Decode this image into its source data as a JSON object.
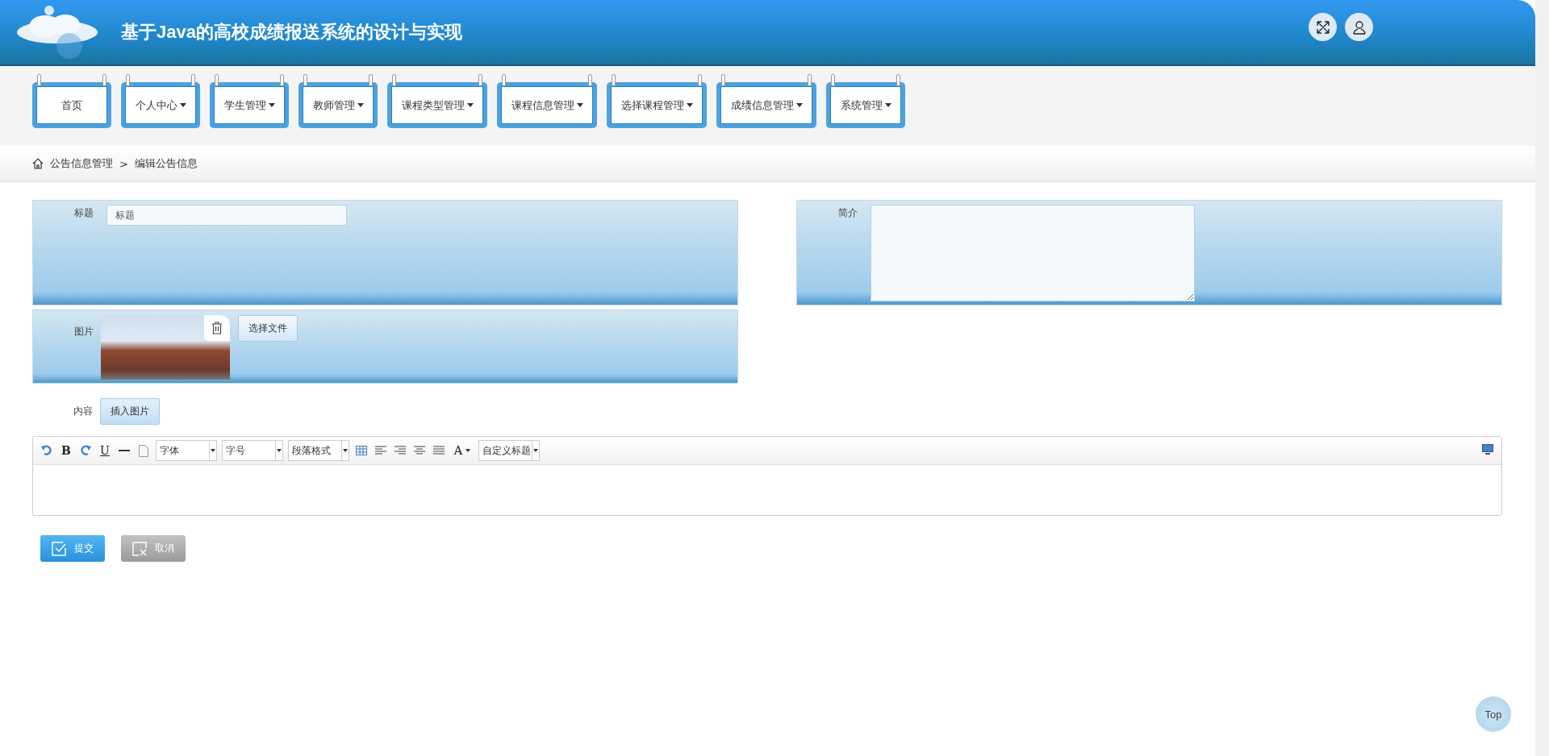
{
  "header": {
    "title": "基于Java的高校成绩报送系统的设计与实现"
  },
  "nav": [
    {
      "label": "首页",
      "dropdown": false
    },
    {
      "label": "个人中心",
      "dropdown": true
    },
    {
      "label": "学生管理",
      "dropdown": true
    },
    {
      "label": "教师管理",
      "dropdown": true
    },
    {
      "label": "课程类型管理",
      "dropdown": true
    },
    {
      "label": "课程信息管理",
      "dropdown": true
    },
    {
      "label": "选择课程管理",
      "dropdown": true
    },
    {
      "label": "成绩信息管理",
      "dropdown": true
    },
    {
      "label": "系统管理",
      "dropdown": true
    }
  ],
  "breadcrumb": {
    "parent": "公告信息管理",
    "separator": ">",
    "current": "编辑公告信息"
  },
  "form": {
    "title_label": "标题",
    "title_placeholder": "标题",
    "summary_label": "简介",
    "image_label": "图片",
    "choose_file": "选择文件",
    "content_label": "内容",
    "insert_image": "插入图片"
  },
  "editor": {
    "toolbar": [
      {
        "kind": "undo"
      },
      {
        "kind": "bold",
        "label": "B"
      },
      {
        "kind": "redo"
      },
      {
        "kind": "underline",
        "label": "U"
      },
      {
        "kind": "hr"
      },
      {
        "kind": "page"
      },
      {
        "kind": "select",
        "label": "字体"
      },
      {
        "kind": "select",
        "label": "字号"
      },
      {
        "kind": "select",
        "label": "段落格式"
      },
      {
        "kind": "table"
      },
      {
        "kind": "align-left"
      },
      {
        "kind": "align-right"
      },
      {
        "kind": "align-center"
      },
      {
        "kind": "justify"
      },
      {
        "kind": "color",
        "label": "A"
      },
      {
        "kind": "select",
        "label": "自定义标题"
      }
    ]
  },
  "buttons": [
    {
      "label": "提交",
      "kind": "submit"
    },
    {
      "label": "取消",
      "kind": "cancel"
    }
  ],
  "top_button": "Top"
}
